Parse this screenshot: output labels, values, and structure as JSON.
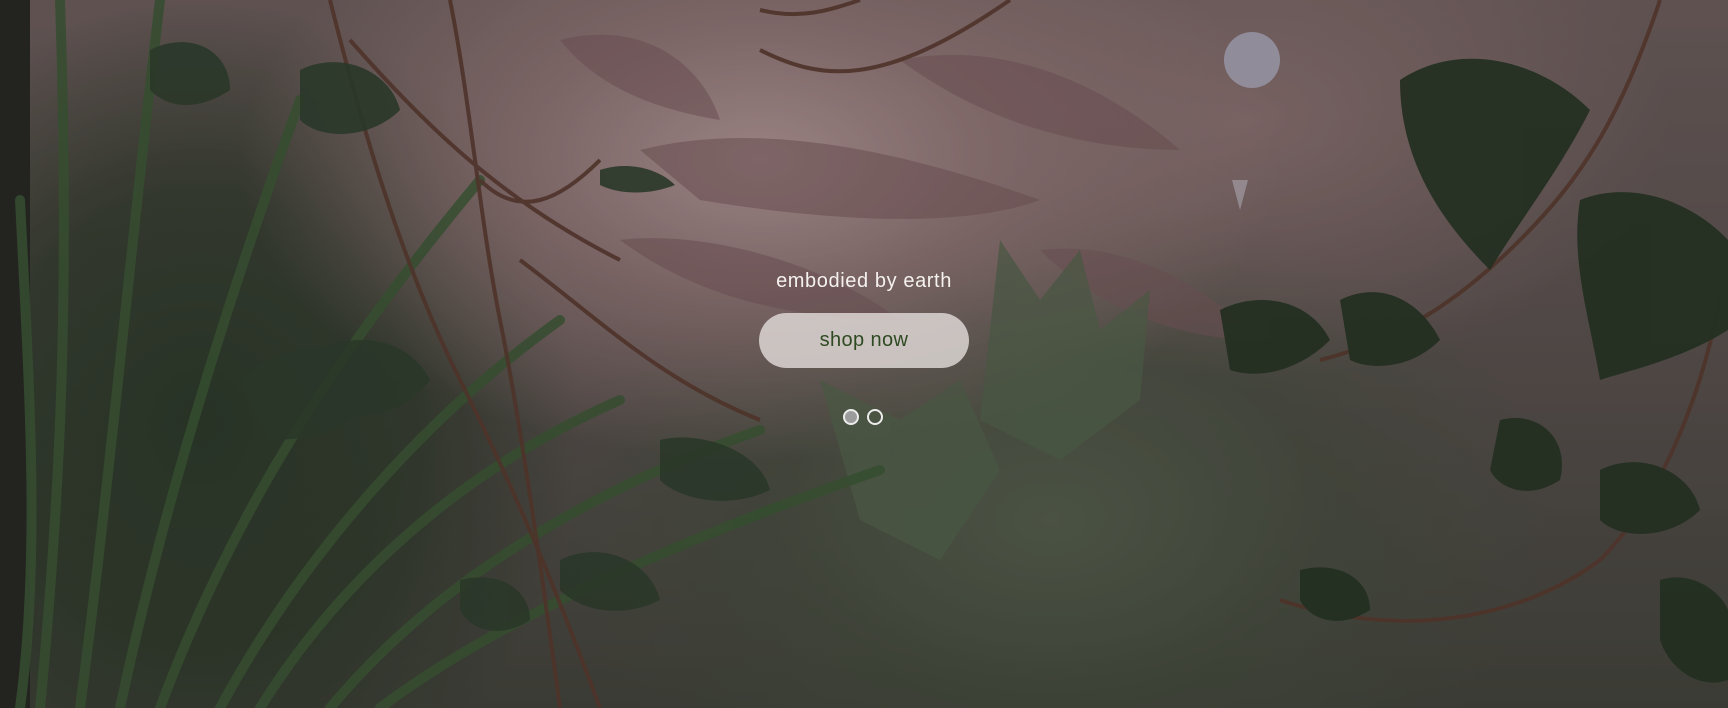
{
  "hero": {
    "tagline": "embodied by earth",
    "cta_label": "shop now",
    "background_image": "leaf-shadows-ivy-on-pink-wall",
    "slides": [
      {
        "name": "slide-1",
        "active": true
      },
      {
        "name": "slide-2",
        "active": false
      }
    ]
  },
  "colors": {
    "tagline": "#f4f1ee",
    "cta_background": "#e1dad8",
    "cta_text": "#2f4a22",
    "dot_active": "#9c9c9c",
    "dot_border": "#ececec"
  }
}
